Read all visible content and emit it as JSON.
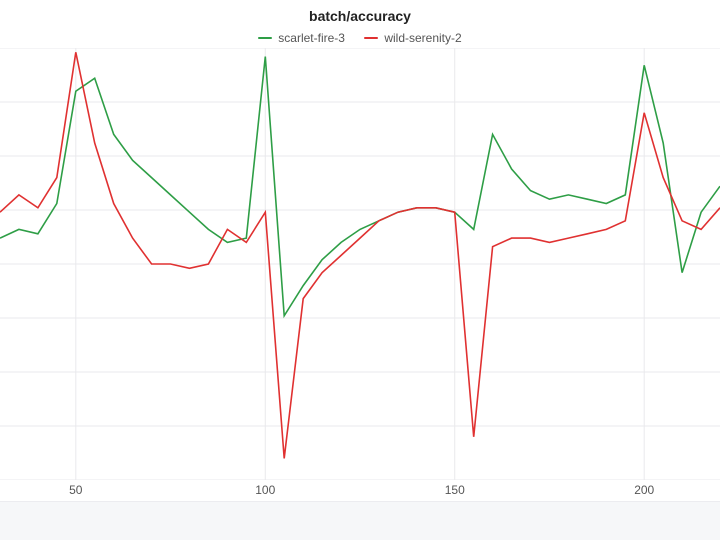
{
  "title": "batch/accuracy",
  "legend": [
    {
      "name": "scarlet-fire-3",
      "color": "#2e9e46"
    },
    {
      "name": "wild-serenity-2",
      "color": "#e03131"
    }
  ],
  "axis": {
    "x_ticks": [
      50,
      100,
      150,
      200
    ],
    "x_min": 30,
    "x_max": 220,
    "y_min": 0.0,
    "y_max": 1.0,
    "y_gridlines": [
      0.0,
      0.125,
      0.25,
      0.375,
      0.5,
      0.625,
      0.75,
      0.875,
      1.0
    ]
  },
  "chart_data": {
    "type": "line",
    "title": "batch/accuracy",
    "xlabel": "",
    "ylabel": "",
    "xlim": [
      30,
      220
    ],
    "ylim": [
      0.0,
      1.0
    ],
    "x": [
      30,
      35,
      40,
      45,
      50,
      55,
      60,
      65,
      70,
      75,
      80,
      85,
      90,
      95,
      100,
      105,
      110,
      115,
      120,
      125,
      130,
      135,
      140,
      145,
      150,
      155,
      160,
      165,
      170,
      175,
      180,
      185,
      190,
      195,
      200,
      205,
      210,
      215,
      220
    ],
    "series": [
      {
        "name": "scarlet-fire-3",
        "color": "#2e9e46",
        "values": [
          0.56,
          0.58,
          0.57,
          0.64,
          0.9,
          0.93,
          0.8,
          0.74,
          0.7,
          0.66,
          0.62,
          0.58,
          0.55,
          0.56,
          0.98,
          0.38,
          0.45,
          0.51,
          0.55,
          0.58,
          0.6,
          0.62,
          0.63,
          0.63,
          0.62,
          0.58,
          0.8,
          0.72,
          0.67,
          0.65,
          0.66,
          0.65,
          0.64,
          0.66,
          0.96,
          0.78,
          0.48,
          0.62,
          0.68
        ]
      },
      {
        "name": "wild-serenity-2",
        "color": "#e03131",
        "values": [
          0.62,
          0.66,
          0.63,
          0.7,
          0.99,
          0.78,
          0.64,
          0.56,
          0.5,
          0.5,
          0.49,
          0.5,
          0.58,
          0.55,
          0.62,
          0.05,
          0.42,
          0.48,
          0.52,
          0.56,
          0.6,
          0.62,
          0.63,
          0.63,
          0.62,
          0.1,
          0.54,
          0.56,
          0.56,
          0.55,
          0.56,
          0.57,
          0.58,
          0.6,
          0.85,
          0.7,
          0.6,
          0.58,
          0.63
        ]
      }
    ]
  }
}
